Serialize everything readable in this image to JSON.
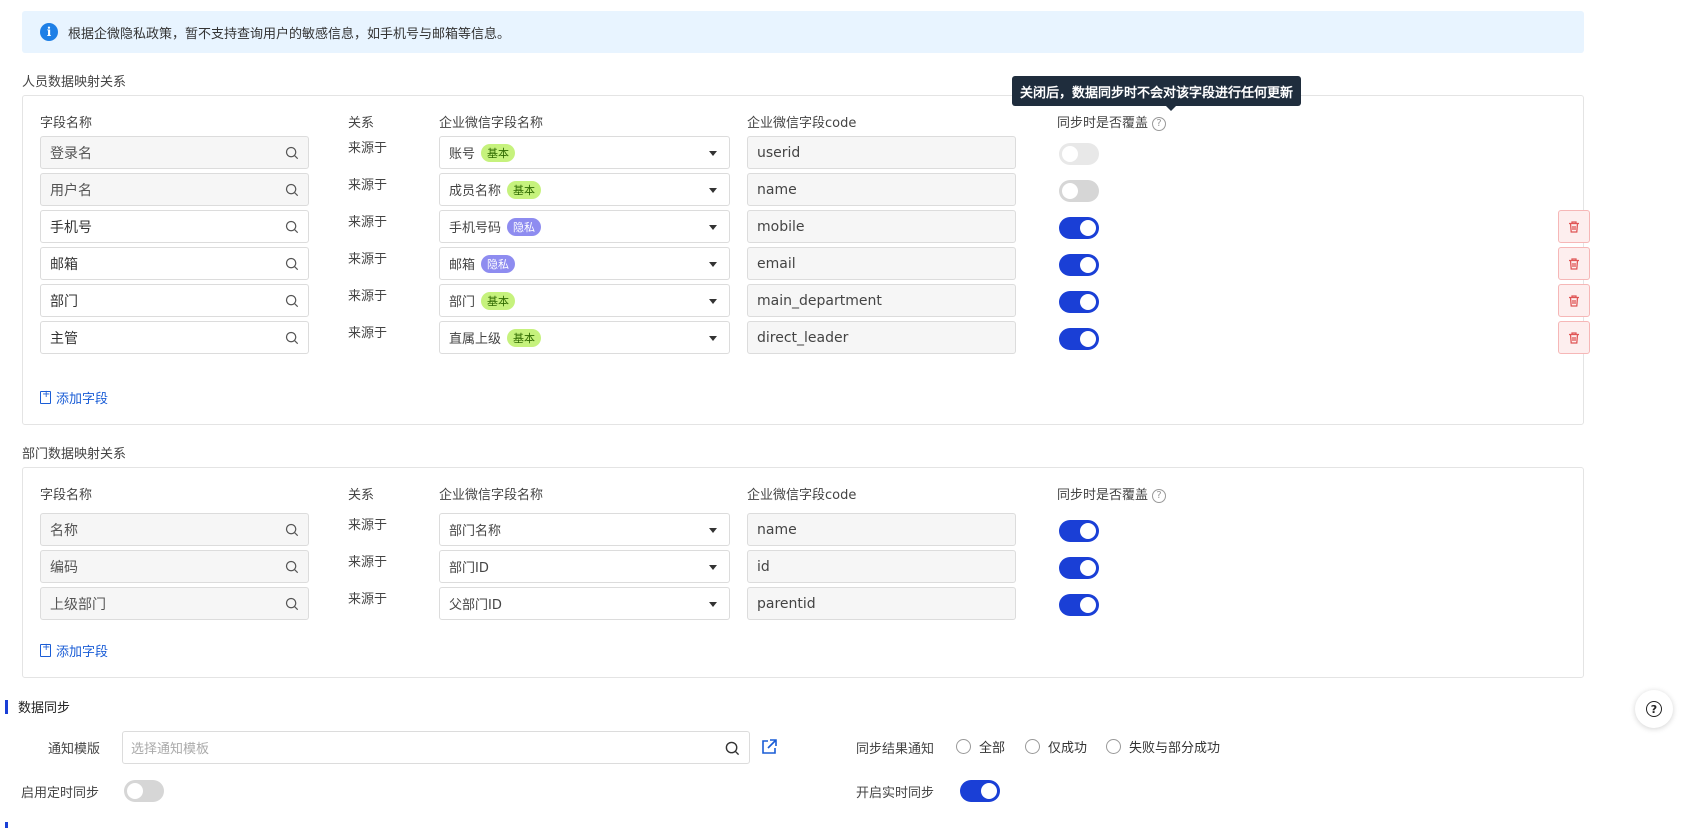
{
  "notice": {
    "icon": "info-icon",
    "text": "根据企微隐私政策，暂不支持查询用户的敏感信息，如手机号与邮箱等信息。"
  },
  "tooltip": "关闭后，数据同步时不会对该字段进行任何更新",
  "columns": {
    "field_name": "字段名称",
    "relation": "关系",
    "wecom_field_name": "企业微信字段名称",
    "wecom_field_code": "企业微信字段code",
    "overwrite": "同步时是否覆盖",
    "help": "?"
  },
  "person_section": {
    "title": "人员数据映射关系",
    "add_label": "添加字段",
    "rows": [
      {
        "field": "登录名",
        "relation": "来源于",
        "wecom_name": "账号",
        "tag": "基本",
        "tag_type": "basic",
        "code": "userid",
        "overwrite": false,
        "deletable": false,
        "editable": false
      },
      {
        "field": "用户名",
        "relation": "来源于",
        "wecom_name": "成员名称",
        "tag": "基本",
        "tag_type": "basic",
        "code": "name",
        "overwrite": false,
        "deletable": false,
        "editable": false
      },
      {
        "field": "手机号",
        "relation": "来源于",
        "wecom_name": "手机号码",
        "tag": "隐私",
        "tag_type": "private",
        "code": "mobile",
        "overwrite": true,
        "deletable": true,
        "editable": true
      },
      {
        "field": "邮箱",
        "relation": "来源于",
        "wecom_name": "邮箱",
        "tag": "隐私",
        "tag_type": "private",
        "code": "email",
        "overwrite": true,
        "deletable": true,
        "editable": true
      },
      {
        "field": "部门",
        "relation": "来源于",
        "wecom_name": "部门",
        "tag": "基本",
        "tag_type": "basic",
        "code": "main_department",
        "overwrite": true,
        "deletable": true,
        "editable": true
      },
      {
        "field": "主管",
        "relation": "来源于",
        "wecom_name": "直属上级",
        "tag": "基本",
        "tag_type": "basic",
        "code": "direct_leader",
        "overwrite": true,
        "deletable": true,
        "editable": true
      }
    ]
  },
  "dept_section": {
    "title": "部门数据映射关系",
    "add_label": "添加字段",
    "rows": [
      {
        "field": "名称",
        "relation": "来源于",
        "wecom_name": "部门名称",
        "code": "name",
        "overwrite": true
      },
      {
        "field": "编码",
        "relation": "来源于",
        "wecom_name": "部门ID",
        "code": "id",
        "overwrite": true
      },
      {
        "field": "上级部门",
        "relation": "来源于",
        "wecom_name": "父部门ID",
        "code": "parentid",
        "overwrite": true
      }
    ]
  },
  "sync": {
    "title": "数据同步",
    "template_label": "通知模版",
    "template_placeholder": "选择通知模板",
    "result_label": "同步结果通知",
    "result_options": [
      "全部",
      "仅成功",
      "失败与部分成功"
    ],
    "scheduled_label": "启用定时同步",
    "scheduled_on": false,
    "realtime_label": "开启实时同步",
    "realtime_on": true
  },
  "colors": {
    "accent": "#1a3fd6",
    "tag_basic": "#c6f27d",
    "tag_private": "#8e8cf0",
    "danger": "#e05656"
  }
}
